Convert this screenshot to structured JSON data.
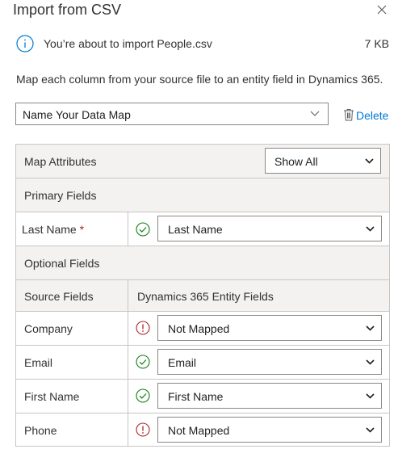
{
  "dialog": {
    "title": "Import from CSV",
    "close_icon": "close-icon"
  },
  "info": {
    "icon": "info-icon",
    "message": "You’re about to import People.csv",
    "file_size": "7 KB"
  },
  "description": "Map each column from your source file to an entity field in Dynamics 365.",
  "data_map": {
    "selected": "Name Your Data Map",
    "delete_label": "Delete"
  },
  "grid": {
    "map_attributes_label": "Map Attributes",
    "filter_selected": "Show All",
    "primary_header": "Primary Fields",
    "optional_header": "Optional Fields",
    "col_source": "Source Fields",
    "col_target": "Dynamics 365 Entity Fields",
    "required_marker": "*",
    "primary_rows": [
      {
        "source": "Last Name",
        "status": "mapped",
        "target": "Last Name"
      }
    ],
    "optional_rows": [
      {
        "source": "Company",
        "status": "not-mapped",
        "target": "Not Mapped"
      },
      {
        "source": "Email",
        "status": "mapped",
        "target": "Email"
      },
      {
        "source": "First Name",
        "status": "mapped",
        "target": "First Name"
      },
      {
        "source": "Phone",
        "status": "not-mapped",
        "target": "Not Mapped"
      }
    ]
  },
  "colors": {
    "accent": "#0078d4",
    "success": "#107c10",
    "error": "#a4262c",
    "border": "#c8c6c4",
    "header_bg": "#f3f2f1"
  }
}
